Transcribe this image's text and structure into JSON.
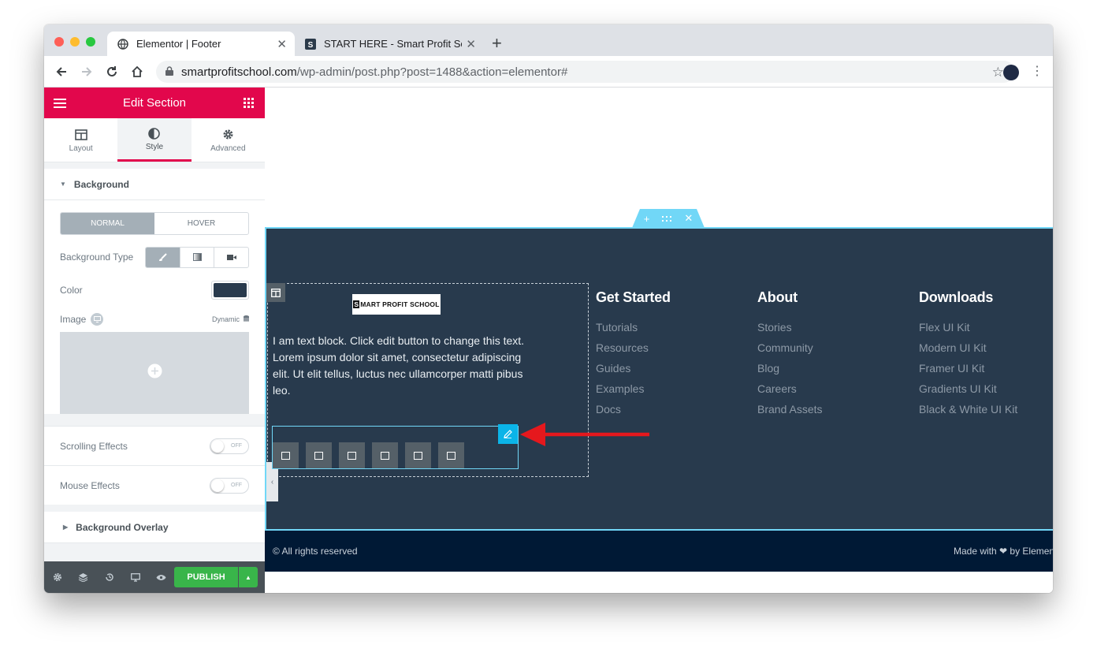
{
  "browser": {
    "tabs": [
      {
        "title": "Elementor | Footer",
        "active": true
      },
      {
        "title": "START HERE - Smart Profit Sc",
        "active": false
      }
    ],
    "new_tab": "+",
    "url_host": "smartprofitschool.com",
    "url_path": "/wp-admin/post.php?post=1488&action=elementor#"
  },
  "panel": {
    "title": "Edit Section",
    "tabs": [
      {
        "label": "Layout",
        "icon": "layout-icon"
      },
      {
        "label": "Style",
        "icon": "half-circle-icon"
      },
      {
        "label": "Advanced",
        "icon": "gear-icon"
      }
    ],
    "background": {
      "title": "Background",
      "state_normal": "NORMAL",
      "state_hover": "HOVER",
      "type_label": "Background Type",
      "color_label": "Color",
      "color_value": "#283a4d",
      "image_label": "Image",
      "dynamic_label": "Dynamic"
    },
    "scrolling_effects": {
      "label": "Scrolling Effects",
      "state": "OFF"
    },
    "mouse_effects": {
      "label": "Mouse Effects",
      "state": "OFF"
    },
    "overlay_title": "Background Overlay",
    "publish_label": "PUBLISH"
  },
  "preview": {
    "logo_text": "MART PROFIT SCHOOL",
    "logo_mark": "S",
    "text_block": "I am text block. Click edit button to change this text. Lorem ipsum dolor sit amet, consectetur adipiscing elit. Ut elit tellus, luctus nec ullamcorper matti pibus leo.",
    "columns": [
      {
        "title": "Get Started",
        "links": [
          "Tutorials",
          "Resources",
          "Guides",
          "Examples",
          "Docs"
        ]
      },
      {
        "title": "About",
        "links": [
          "Stories",
          "Community",
          "Blog",
          "Careers",
          "Brand Assets"
        ]
      },
      {
        "title": "Downloads",
        "links": [
          "Flex UI Kit",
          "Modern UI Kit",
          "Framer UI Kit",
          "Gradients UI Kit",
          "Black & White UI Kit"
        ]
      }
    ],
    "copyright": "© All rights reserved",
    "made_with": "Made with ❤ by Elemen"
  },
  "colors": {
    "elementor_pink": "#e2074c",
    "footer_bg": "#283a4d",
    "bottom_bar_bg": "#001935",
    "selection_blue": "#71d7f7",
    "publish_green": "#39b54a",
    "arrow_red": "#e5181d"
  }
}
